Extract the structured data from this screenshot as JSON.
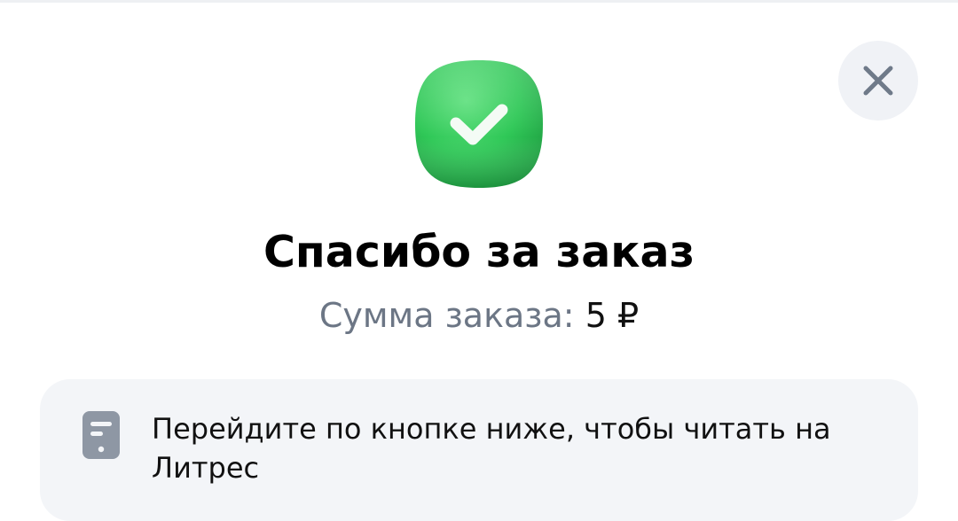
{
  "dialog": {
    "close_icon": "close-icon",
    "success_icon": "check-icon",
    "title": "Спасибо за заказ",
    "sum_label": "Сумма заказа:",
    "sum_value": "5 ₽"
  },
  "info": {
    "icon": "reader-device-icon",
    "text": "Перейдите по кнопке ниже, чтобы читать на Литрес"
  },
  "colors": {
    "success_green": "#2ecc5a",
    "close_bg": "#f0f2f6",
    "close_icon": "#6f7a89",
    "card_bg": "#f3f5f8",
    "muted_text": "#6c7685",
    "icon_gray": "#8e97a4"
  }
}
